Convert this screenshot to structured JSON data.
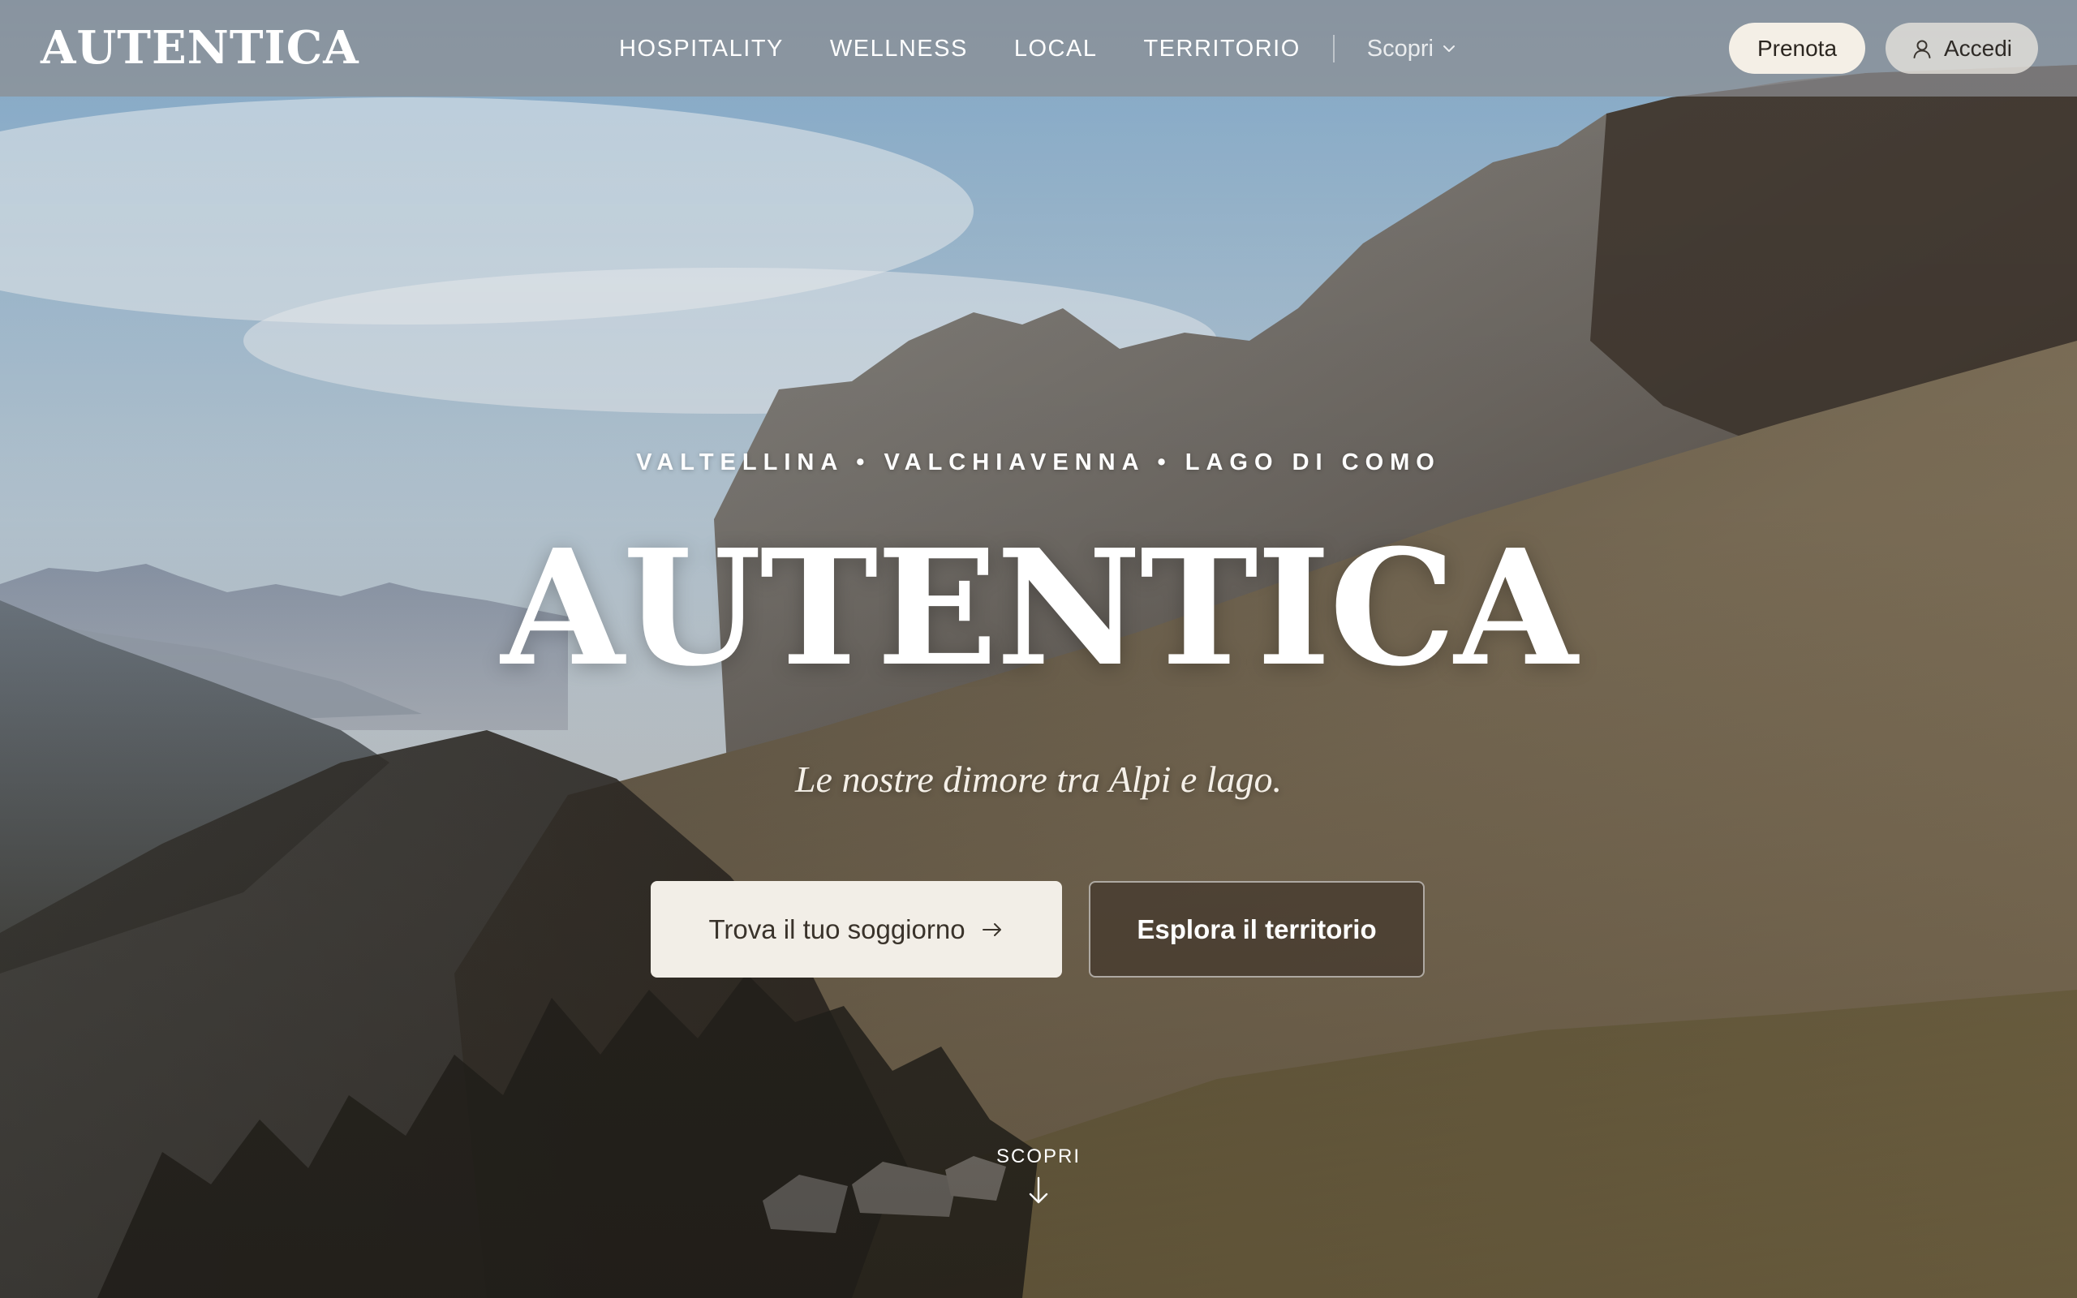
{
  "brand": {
    "name": "AUTENTICA"
  },
  "nav": {
    "items": [
      {
        "label": "HOSPITALITY"
      },
      {
        "label": "WELLNESS"
      },
      {
        "label": "LOCAL"
      },
      {
        "label": "TERRITORIO"
      }
    ],
    "more_label": "Scopri",
    "more_icon": "chevron-down-icon"
  },
  "header_actions": {
    "book_label": "Prenota",
    "login_label": "Accedi",
    "login_icon": "user-icon"
  },
  "hero": {
    "eyebrow": "VALTELLINA • VALCHIAVENNA • LAGO DI COMO",
    "title": "AUTENTICA",
    "tagline": "Le nostre dimore tra Alpi e lago.",
    "primary_cta": "Trova il tuo soggiorno",
    "primary_cta_icon": "arrow-right-icon",
    "secondary_cta": "Esplora il territorio",
    "scroll_label": "SCOPRI",
    "scroll_icon": "arrow-down-icon"
  },
  "colors": {
    "header_bg": "#8c8e92",
    "cta_light": "#f2eee7",
    "cta_dark": "#3c3026",
    "text_light": "#ffffff"
  }
}
